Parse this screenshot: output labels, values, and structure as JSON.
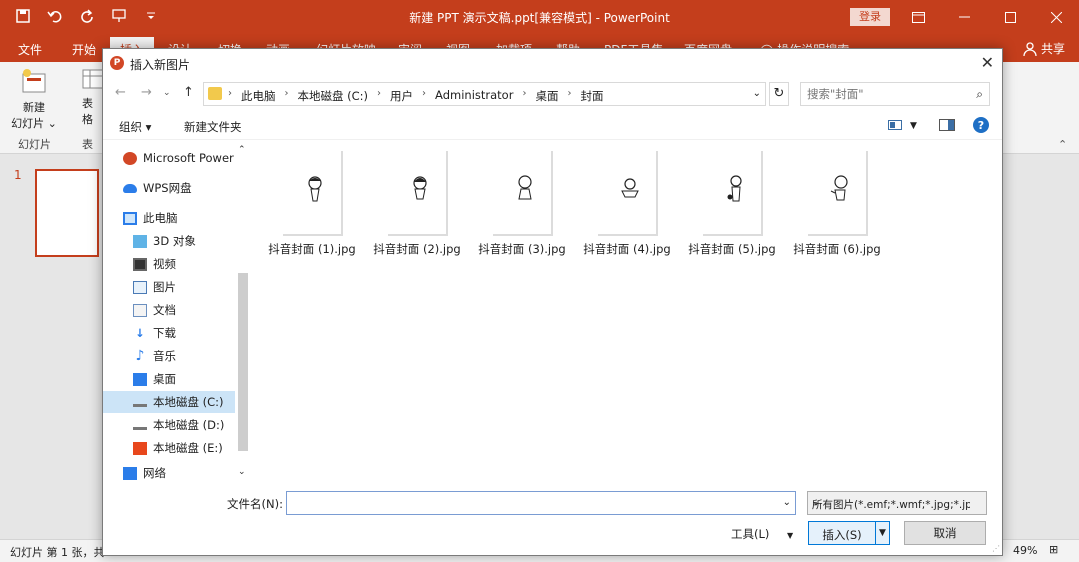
{
  "window": {
    "title": "新建 PPT 演示文稿.ppt[兼容模式] - PowerPoint",
    "login_label": "登录"
  },
  "ribbon": {
    "tabs": [
      "文件",
      "开始",
      "插入",
      "设计",
      "切换",
      "动画",
      "幻灯片放映",
      "审阅",
      "视图",
      "加载项",
      "帮助",
      "PDF工具集",
      "百度网盘",
      "操作说明搜索"
    ],
    "share_label": "共享",
    "new_slide_label": "新建",
    "new_slide_label2": "幻灯片",
    "table_label": "表格",
    "slides_group": "幻灯片",
    "tables_group": "表格"
  },
  "slides_pane": {
    "slide_number": "1"
  },
  "statusbar": {
    "slide_info": "幻灯片 第 1 张，共",
    "zoom": "49%"
  },
  "dialog": {
    "title": "插入新图片",
    "breadcrumb": [
      "此电脑",
      "本地磁盘 (C:)",
      "用户",
      "Administrator",
      "桌面",
      "封面"
    ],
    "search_placeholder": "搜索\"封面\"",
    "organize_label": "组织 ▾",
    "new_folder_label": "新建文件夹",
    "nav_items": [
      {
        "label": "Microsoft Power",
        "icon": "powerpoint-icon"
      },
      {
        "label": "WPS网盘",
        "icon": "cloud-icon"
      },
      {
        "label": "此电脑",
        "icon": "computer-icon"
      },
      {
        "label": "3D 对象",
        "icon": "cube-icon"
      },
      {
        "label": "视频",
        "icon": "video-icon"
      },
      {
        "label": "图片",
        "icon": "pictures-icon"
      },
      {
        "label": "文档",
        "icon": "documents-icon"
      },
      {
        "label": "下载",
        "icon": "download-icon"
      },
      {
        "label": "音乐",
        "icon": "music-icon"
      },
      {
        "label": "桌面",
        "icon": "desktop-icon"
      },
      {
        "label": "本地磁盘 (C:)",
        "icon": "drive-icon"
      },
      {
        "label": "本地磁盘 (D:)",
        "icon": "drive-icon"
      },
      {
        "label": "本地磁盘 (E:)",
        "icon": "office-drive-icon"
      },
      {
        "label": "网络",
        "icon": "network-icon"
      }
    ],
    "files": [
      {
        "name": "抖音封面 (1).jpg"
      },
      {
        "name": "抖音封面 (2).jpg"
      },
      {
        "name": "抖音封面 (3).jpg"
      },
      {
        "name": "抖音封面 (4).jpg"
      },
      {
        "name": "抖音封面 (5).jpg"
      },
      {
        "name": "抖音封面 (6).jpg"
      }
    ],
    "filename_label": "文件名(N):",
    "filename_value": "",
    "filetype_value": "所有图片(*.emf;*.wmf;*.jpg;*.jp",
    "tools_label": "工具(L)",
    "insert_label": "插入(S)",
    "cancel_label": "取消"
  },
  "colors": {
    "accent": "#c43e1c",
    "selection": "#cce4f7"
  }
}
